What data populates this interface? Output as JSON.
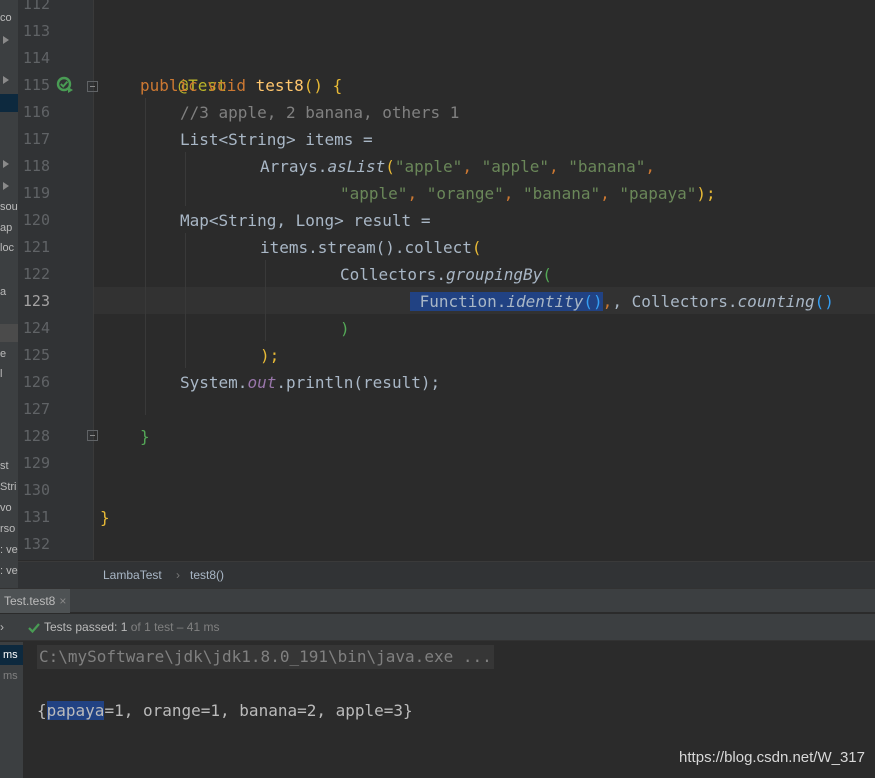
{
  "editor": {
    "line_numbers": [
      "112",
      "113",
      "114",
      "115",
      "116",
      "117",
      "118",
      "119",
      "120",
      "121",
      "122",
      "123",
      "124",
      "125",
      "126",
      "127",
      "128",
      "129",
      "130",
      "131",
      "132"
    ],
    "current_line": "123",
    "code": {
      "l114_annotation": "@Test",
      "l115_kw1": "public",
      "l115_kw2": "void",
      "l115_name": "test8",
      "l115_rest": "() {",
      "l116_comment": "//3 apple, 2 banana, others 1",
      "l117_a": "List<",
      "l117_b": "String",
      "l117_c": "> items =",
      "l118_a": "Arrays.",
      "l118_b": "asList",
      "l118_c": "(",
      "l118_s1": "\"apple\"",
      "l118_s2": "\"apple\"",
      "l118_s3": "\"banana\"",
      "l119_s1": "\"apple\"",
      "l119_s2": "\"orange\"",
      "l119_s3": "\"banana\"",
      "l119_s4": "\"papaya\"",
      "l119_end": ");",
      "l120_a": "Map<",
      "l120_b": "String, Long",
      "l120_c": "> result =",
      "l121_a": "items.stream().collect",
      "l121_b": "(",
      "l122_a": "Collectors.",
      "l122_b": "groupingBy",
      "l122_c": "(",
      "l123_a": "Function.",
      "l123_b": "identity",
      "l123_c": "()",
      "l123_d": ", Collectors.",
      "l123_e": "counting",
      "l123_f": "()",
      "l124": ")",
      "l125": ");",
      "l126_a": "System.",
      "l126_b": "out",
      "l126_c": ".println(result);",
      "l128": "}",
      "l131": "}"
    }
  },
  "left_strip": [
    "co",
    "sou",
    "ap",
    "loc",
    "a",
    "e",
    "l",
    "st",
    "Stri",
    "vo",
    "rso",
    ": ve",
    ": ve"
  ],
  "breadcrumb": {
    "class": "LambaTest",
    "separator": "›",
    "method": "test8()"
  },
  "run_panel": {
    "tab_label": "Test.test8",
    "tab_close": "×",
    "status_prefix": "Tests passed: ",
    "status_count": "1",
    "status_dim": " of 1 test – 41 ms",
    "tree_items": [
      "ms",
      "ms"
    ]
  },
  "console": {
    "command": "C:\\mySoftware\\jdk\\jdk1.8.0_191\\bin\\java.exe ...",
    "output_open": "{",
    "output_hl": "papaya",
    "output_rest": "=1, orange=1, banana=2, apple=3}"
  },
  "watermark": "https://blog.csdn.net/W_317",
  "colors": {
    "background": "#2b2b2b",
    "keyword": "#cc7832",
    "string": "#6a8759",
    "selection": "#214283"
  }
}
